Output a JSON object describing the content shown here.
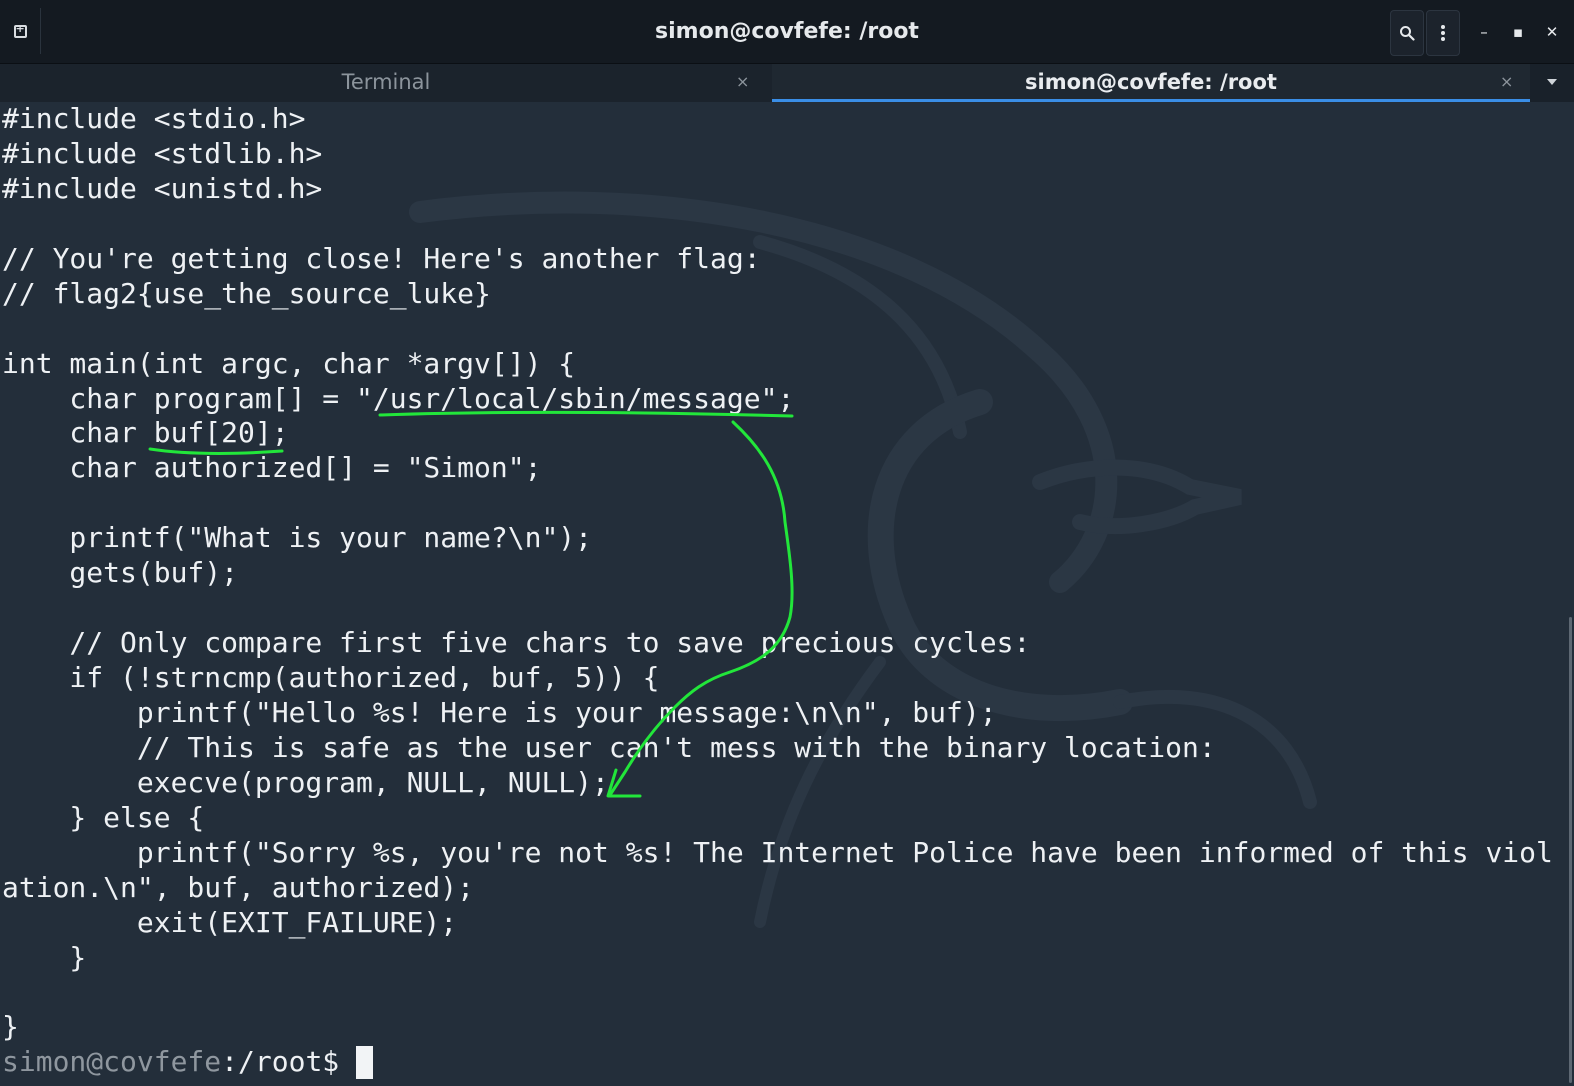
{
  "window": {
    "title": "simon@covfefe: /root"
  },
  "tabs": [
    {
      "label": "Terminal",
      "close": "×",
      "active": false
    },
    {
      "label": "simon@covfefe: /root",
      "close": "×",
      "active": true
    }
  ],
  "icons": {
    "new_tab": "new-tab-icon",
    "search": "search-icon",
    "menu": "kebab-menu-icon",
    "minimize": "minimize-icon",
    "maximize": "maximize-icon",
    "close": "close-icon",
    "tab_list": "chevron-down-icon"
  },
  "window_controls": {
    "minimize": "–",
    "maximize": "▪",
    "close": "✕"
  },
  "code_lines": [
    "#include <stdio.h>",
    "#include <stdlib.h>",
    "#include <unistd.h>",
    "",
    "// You're getting close! Here's another flag:",
    "// flag2{use_the_source_luke}",
    "",
    "int main(int argc, char *argv[]) {",
    "    char program[] = \"/usr/local/sbin/message\";",
    "    char buf[20];",
    "    char authorized[] = \"Simon\";",
    "",
    "    printf(\"What is your name?\\n\");",
    "    gets(buf);",
    "",
    "    // Only compare first five chars to save precious cycles:",
    "    if (!strncmp(authorized, buf, 5)) {",
    "        printf(\"Hello %s! Here is your message:\\n\\n\", buf);",
    "        // This is safe as the user can't mess with the binary location:",
    "        execve(program, NULL, NULL);",
    "    } else {",
    "        printf(\"Sorry %s, you're not %s! The Internet Police have been informed of this viol",
    "ation.\\n\", buf, authorized);",
    "        exit(EXIT_FAILURE);",
    "    }",
    "",
    "}"
  ],
  "prompt": {
    "user_host": "simon@covfefe",
    "path": ":/root$ "
  },
  "colors": {
    "terminal_bg": "#232e3a",
    "text": "#eef1f4",
    "prompt_user": "#8f979f",
    "annotation": "#22e63a",
    "tab_active_underline": "#3a8ee6"
  }
}
